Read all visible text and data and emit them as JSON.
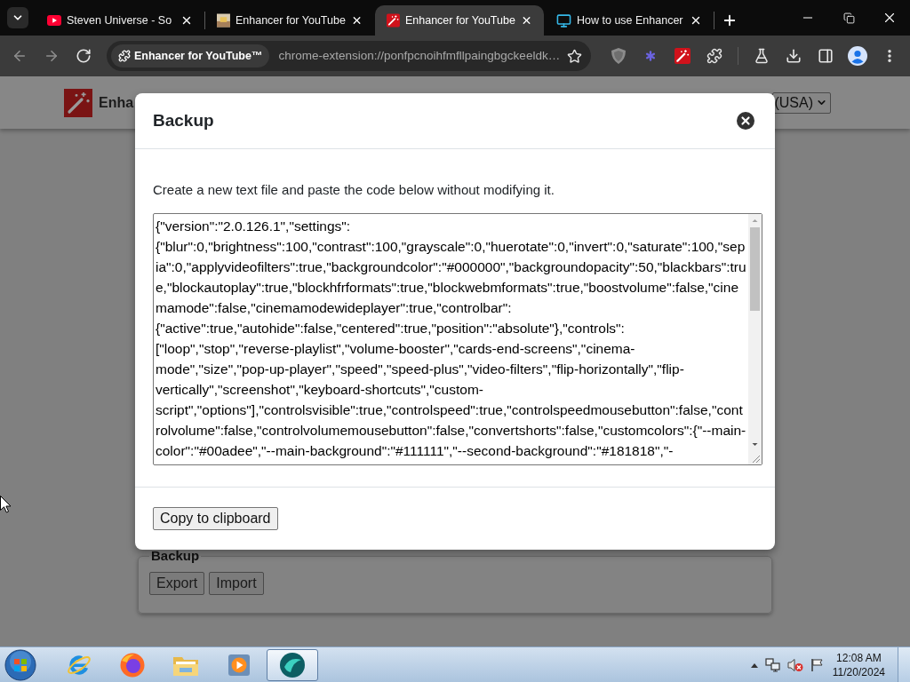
{
  "browser": {
    "tabs": [
      {
        "kind": "play",
        "title": "Steven Universe - So",
        "selected": false
      },
      {
        "kind": "thumbnail",
        "title": "Enhancer for YouTube",
        "selected": false
      },
      {
        "kind": "wand",
        "title": "Enhancer for YouTube",
        "selected": true
      },
      {
        "kind": "monitor",
        "title": "How to use Enhancer",
        "selected": false
      }
    ],
    "navigation": [
      {
        "kind": "back",
        "disabled": true
      },
      {
        "kind": "forward",
        "disabled": true
      },
      {
        "kind": "reload",
        "disabled": false
      }
    ],
    "omnibox": {
      "chip": "Enhancer for YouTube™",
      "url": "chrome-extension://ponfpcnoihfmfllpaingbgckeeldk…"
    }
  },
  "page": {
    "header": {
      "title": "Enha",
      "language": "(USA)"
    },
    "backup_section": {
      "legend": "Backup",
      "buttons": [
        "Export",
        "Import"
      ]
    }
  },
  "modal": {
    "title": "Backup",
    "instruction": "Create a new text file and paste the code below without modifying it.",
    "code": "{\"version\":\"2.0.126.1\",\"settings\":{\"blur\":0,\"brightness\":100,\"contrast\":100,\"grayscale\":0,\"huerotate\":0,\"invert\":0,\"saturate\":100,\"sepia\":0,\"applyvideofilters\":true,\"backgroundcolor\":\"#000000\",\"backgroundopacity\":50,\"blackbars\":true,\"blockautoplay\":true,\"blockhfrformats\":true,\"blockwebmformats\":true,\"boostvolume\":false,\"cinemamode\":false,\"cinemamodewideplayer\":true,\"controlbar\":{\"active\":true,\"autohide\":false,\"centered\":true,\"position\":\"absolute\"},\"controls\":[\"loop\",\"stop\",\"reverse-playlist\",\"volume-booster\",\"cards-end-screens\",\"cinema-mode\",\"size\",\"pop-up-player\",\"speed\",\"speed-plus\",\"video-filters\",\"flip-horizontally\",\"flip-vertically\",\"screenshot\",\"keyboard-shortcuts\",\"custom-script\",\"options\"],\"controlsvisible\":true,\"controlspeed\":true,\"controlspeedmousebutton\":false,\"controlvolume\":false,\"controlvolumemousebutton\":false,\"convertshorts\":false,\"customcolors\":{\"--main-color\":\"#00adee\",\"--main-background\":\"#111111\",\"--second-background\":\"#181818\",\"-",
    "button": "Copy to clipboard"
  },
  "taskbar": {
    "apps": [
      {
        "kind": "browser-e",
        "selected": false
      },
      {
        "kind": "browser-flame",
        "selected": false
      },
      {
        "kind": "folder",
        "selected": false
      },
      {
        "kind": "media",
        "selected": false
      },
      {
        "kind": "orb",
        "selected": true
      }
    ],
    "tray": {
      "volume_muted": true
    },
    "clock": {
      "time": "12:08 AM",
      "date": "11/20/2024"
    }
  }
}
